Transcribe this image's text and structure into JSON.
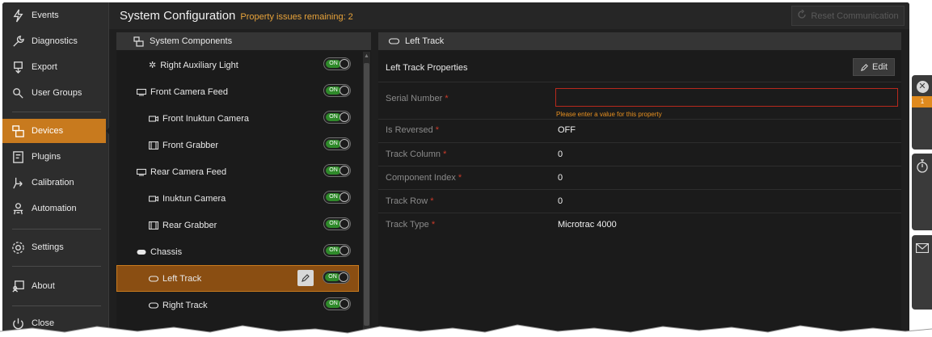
{
  "sidebar": {
    "items": [
      {
        "label": "Events",
        "icon": "lightning-icon"
      },
      {
        "label": "Diagnostics",
        "icon": "wrench-icon"
      },
      {
        "label": "Export",
        "icon": "export-icon"
      },
      {
        "label": "User Groups",
        "icon": "user-groups-icon"
      },
      {
        "label": "Devices",
        "icon": "devices-icon"
      },
      {
        "label": "Plugins",
        "icon": "plugins-icon"
      },
      {
        "label": "Calibration",
        "icon": "calibration-icon"
      },
      {
        "label": "Automation",
        "icon": "automation-icon"
      },
      {
        "label": "Settings",
        "icon": "gear-icon"
      },
      {
        "label": "About",
        "icon": "about-icon"
      },
      {
        "label": "Close",
        "icon": "power-icon"
      }
    ],
    "active": "Devices",
    "accent_color": "#c87a1e"
  },
  "header": {
    "title": "System Configuration",
    "issues": "Property issues remaining: 2",
    "reset_label": "Reset Communication"
  },
  "components": {
    "title": "System Components",
    "items": [
      {
        "label": "Right Auxiliary Light",
        "toggle": "ON",
        "icon": "light-icon"
      },
      {
        "label": "Front Camera Feed",
        "toggle": "ON",
        "icon": "camera-feed-icon"
      },
      {
        "label": "Front Inuktun Camera",
        "toggle": "ON",
        "icon": "camera-icon"
      },
      {
        "label": "Front Grabber",
        "toggle": "ON",
        "icon": "grabber-icon"
      },
      {
        "label": "Rear Camera Feed",
        "toggle": "ON",
        "icon": "camera-feed-icon"
      },
      {
        "label": "Inuktun Camera",
        "toggle": "ON",
        "icon": "camera-icon"
      },
      {
        "label": "Rear Grabber",
        "toggle": "ON",
        "icon": "grabber-icon"
      },
      {
        "label": "Chassis",
        "toggle": "ON",
        "icon": "chassis-icon"
      },
      {
        "label": "Left Track",
        "toggle": "ON",
        "icon": "track-icon",
        "selected": true
      },
      {
        "label": "Right Track",
        "toggle": "ON",
        "icon": "track-icon"
      }
    ]
  },
  "properties": {
    "panel_title": "Left Track",
    "section_title": "Left Track Properties",
    "edit_label": "Edit",
    "serial": {
      "label": "Serial Number",
      "value": "",
      "error": "Please enter a value for this property"
    },
    "rows": [
      {
        "label": "Is Reversed",
        "value": "OFF"
      },
      {
        "label": "Track Column",
        "value": "0"
      },
      {
        "label": "Component Index",
        "value": "0"
      },
      {
        "label": "Track Row",
        "value": "0"
      },
      {
        "label": "Track Type",
        "value": "Microtrac 4000"
      }
    ],
    "required_marker": "*"
  },
  "right_rail": {
    "badge_count": "1"
  }
}
